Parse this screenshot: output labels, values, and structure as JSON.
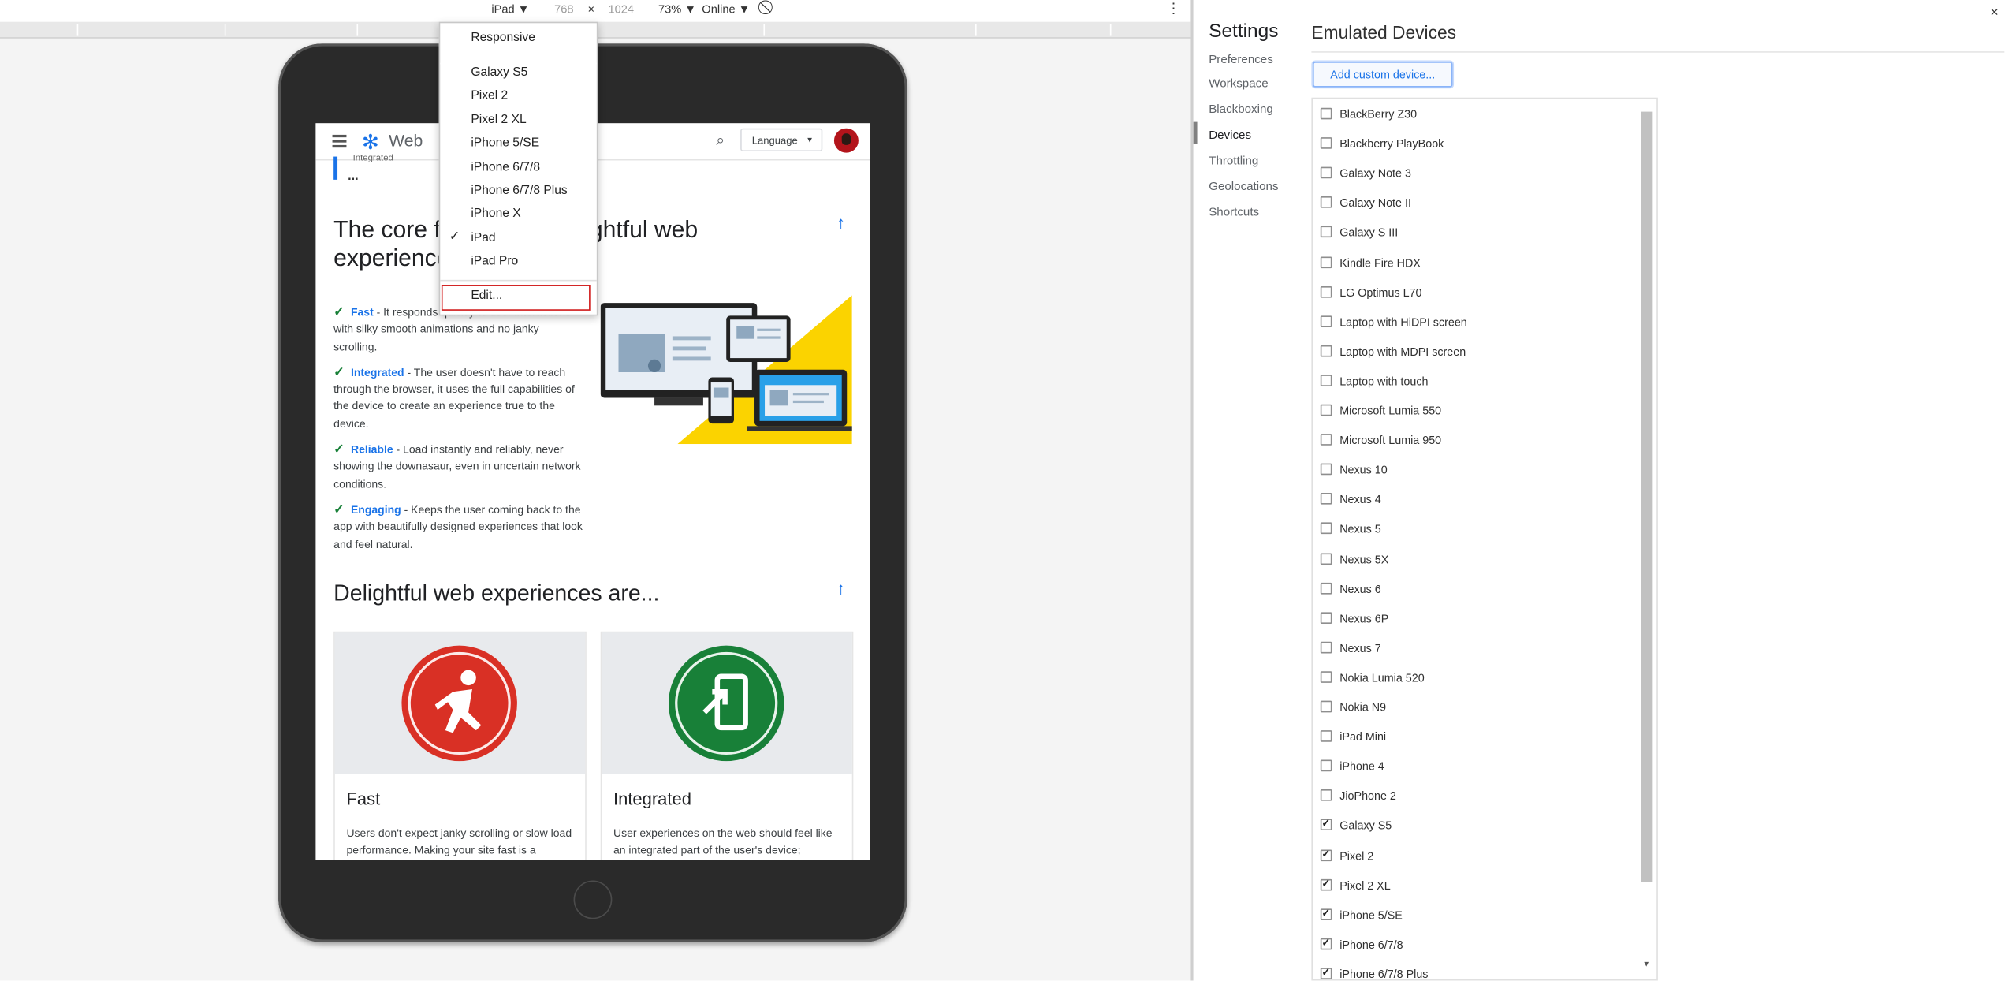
{
  "toolbar": {
    "device": "iPad ▼",
    "width": "768",
    "times": "×",
    "height": "1024",
    "zoom": "73% ▼",
    "network": "Online ▼",
    "rotate_icon": "⃠",
    "more_icon": "⋮"
  },
  "menu": {
    "checkmark": "✓",
    "items": [
      "Responsive",
      "Galaxy S5",
      "Pixel 2",
      "Pixel 2 XL",
      "iPhone 5/SE",
      "iPhone 6/7/8",
      "iPhone 6/7/8 Plus",
      "iPhone X",
      "iPad",
      "iPad Pro",
      "Edit..."
    ],
    "selected": "iPad"
  },
  "site": {
    "name": "Web",
    "logo_icon": "✻",
    "search_icon": "⌕",
    "language": "Language",
    "prev_label": "Integrated",
    "prev_dots": "...",
    "heading1": "The core features of delightful web experiences",
    "up_icon": "↑",
    "check_icon": "✓",
    "bullets": [
      {
        "kw": "Fast",
        "text": " - It responds quickly to user interactions with silky smooth animations and no janky scrolling."
      },
      {
        "kw": "Integrated",
        "text": " - The user doesn't have to reach through the browser, it uses the full capabilities of the device to create an experience true to the device."
      },
      {
        "kw": "Reliable",
        "text": " - Load instantly and reliably, never showing the downasaur, even in uncertain network conditions."
      },
      {
        "kw": "Engaging",
        "text": " - Keeps the user coming back to the app with beautifully designed experiences that look and feel natural."
      }
    ],
    "heading2": "Delightful web experiences are...",
    "cards": [
      {
        "title": "Fast",
        "text": "Users don't expect janky scrolling or slow load performance. Making your site fast is a",
        "color": "#d93025"
      },
      {
        "title": "Integrated",
        "text": "User experiences on the web should feel like an integrated part of the user's device;",
        "color": "#188038"
      }
    ]
  },
  "settings": {
    "title": "Settings",
    "close_icon": "×",
    "nav": [
      "Preferences",
      "Workspace",
      "Blackboxing",
      "Devices",
      "Throttling",
      "Geolocations",
      "Shortcuts"
    ],
    "active": "Devices",
    "panel_title": "Emulated Devices",
    "add_button": "Add custom device...",
    "devices": [
      {
        "name": "BlackBerry Z30",
        "checked": false
      },
      {
        "name": "Blackberry PlayBook",
        "checked": false
      },
      {
        "name": "Galaxy Note 3",
        "checked": false
      },
      {
        "name": "Galaxy Note II",
        "checked": false
      },
      {
        "name": "Galaxy S III",
        "checked": false
      },
      {
        "name": "Kindle Fire HDX",
        "checked": false
      },
      {
        "name": "LG Optimus L70",
        "checked": false
      },
      {
        "name": "Laptop with HiDPI screen",
        "checked": false
      },
      {
        "name": "Laptop with MDPI screen",
        "checked": false
      },
      {
        "name": "Laptop with touch",
        "checked": false
      },
      {
        "name": "Microsoft Lumia 550",
        "checked": false
      },
      {
        "name": "Microsoft Lumia 950",
        "checked": false
      },
      {
        "name": "Nexus 10",
        "checked": false
      },
      {
        "name": "Nexus 4",
        "checked": false
      },
      {
        "name": "Nexus 5",
        "checked": false
      },
      {
        "name": "Nexus 5X",
        "checked": false
      },
      {
        "name": "Nexus 6",
        "checked": false
      },
      {
        "name": "Nexus 6P",
        "checked": false
      },
      {
        "name": "Nexus 7",
        "checked": false
      },
      {
        "name": "Nokia Lumia 520",
        "checked": false
      },
      {
        "name": "Nokia N9",
        "checked": false
      },
      {
        "name": "iPad Mini",
        "checked": false
      },
      {
        "name": "iPhone 4",
        "checked": false
      },
      {
        "name": "JioPhone 2",
        "checked": false
      },
      {
        "name": "Galaxy S5",
        "checked": true
      },
      {
        "name": "Pixel 2",
        "checked": true
      },
      {
        "name": "Pixel 2 XL",
        "checked": true
      },
      {
        "name": "iPhone 5/SE",
        "checked": true
      },
      {
        "name": "iPhone 6/7/8",
        "checked": true
      },
      {
        "name": "iPhone 6/7/8 Plus",
        "checked": true
      }
    ],
    "scroll_down_icon": "▼"
  }
}
